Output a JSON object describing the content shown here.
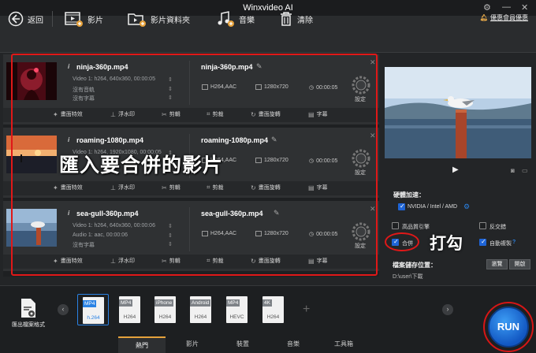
{
  "app": {
    "title": "Winxvideo AI"
  },
  "toolbar": {
    "back": "返回",
    "video": "影片",
    "video_folder": "影片資料夾",
    "music": "音樂",
    "clear": "清除",
    "promo": "優惠會員優惠"
  },
  "videos": [
    {
      "source_name": "ninja-360p.mp4",
      "video_info": "Video 1: h264, 640x360, 00:00:05",
      "audio_info": "沒有音軌",
      "subtitle_info": "沒有字幕",
      "output_name": "ninja-360p.mp4",
      "codec": "H264,AAC",
      "resolution": "1280x720",
      "duration": "00:00:05"
    },
    {
      "source_name": "roaming-1080p.mp4",
      "video_info": "Video 1: h264, 1920x1080, 00:00:05",
      "audio_info": "",
      "subtitle_info": "",
      "output_name": "roaming-1080p.mp4",
      "codec": "H264,AAC",
      "resolution": "1280x720",
      "duration": "00:00:05"
    },
    {
      "source_name": "sea-gull-360p.mp4",
      "video_info": "Video 1: h264, 640x360, 00:00:06",
      "audio_info": "Audio 1: aac, 00:00:06",
      "subtitle_info": "沒有字幕",
      "output_name": "sea-gull-360p.mp4",
      "codec": "H264,AAC",
      "resolution": "1280x720",
      "duration": "00:00:05"
    }
  ],
  "card_actions": {
    "effects": "畫面特效",
    "watermark": "浮水印",
    "cut": "剪輯",
    "crop": "剪裁",
    "rotate": "畫面旋轉",
    "subtitle": "字幕",
    "settings": "設定"
  },
  "annotations": {
    "import_text": "匯入要合併的影片",
    "check_text": "打勾"
  },
  "options": {
    "hw_accel": "硬體加速：",
    "hw_brand": "NVIDIA / Intel / AMD",
    "high_quality": "高品質引擎",
    "deinterlace": "反交錯",
    "merge": "合併",
    "auto_copy": "自動複製",
    "auto_copy_help": "?",
    "save_folder_label": "檔案儲存位置：",
    "save_path": "D:\\user\\下載",
    "browse": "瀏覽",
    "open": "開啟"
  },
  "bottom": {
    "export_label": "匯出檔案格式",
    "presets": [
      {
        "tag": "MP4",
        "fmt": "h.264"
      },
      {
        "tag": "MP4",
        "fmt": "H264"
      },
      {
        "tag": "iPhone",
        "fmt": "H264"
      },
      {
        "tag": "Android",
        "fmt": "H264"
      },
      {
        "tag": "MP4",
        "fmt": "HEVC"
      },
      {
        "tag": "4K",
        "fmt": "H264"
      }
    ],
    "tabs": [
      "熱門",
      "影片",
      "裝置",
      "音樂",
      "工具箱"
    ],
    "run": "RUN"
  },
  "colors": {
    "accent_blue": "#2a82e4",
    "annotation_red": "#e01818",
    "promo_orange": "#f2b04a"
  }
}
